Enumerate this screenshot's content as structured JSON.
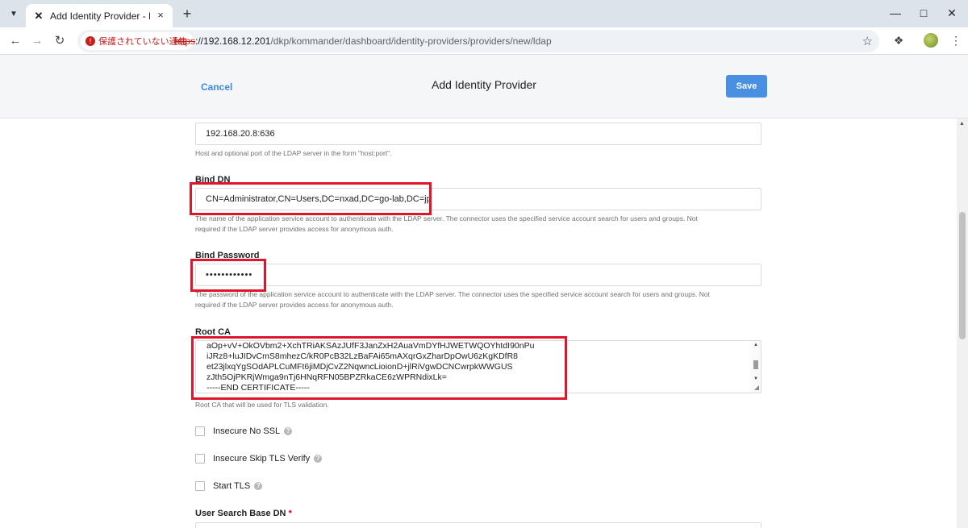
{
  "browser": {
    "tab_title": "Add Identity Provider - Nutanix",
    "tab_close": "×",
    "new_tab": "+",
    "security_label": "保護されていない通信",
    "url_scheme": "https",
    "url_host": "://192.168.12.201",
    "url_path": "/dkp/kommander/dashboard/identity-providers/providers/new/ldap"
  },
  "header": {
    "cancel_label": "Cancel",
    "title": "Add Identity Provider",
    "save_label": "Save"
  },
  "form": {
    "host": {
      "value": "192.168.20.8:636",
      "help": "Host and optional port of the LDAP server in the form \"host:port\"."
    },
    "bind_dn": {
      "label": "Bind DN",
      "value": "CN=Administrator,CN=Users,DC=nxad,DC=go-lab,DC=jp",
      "help_line1": "The name of the application service account to authenticate with the LDAP server. The connector uses the specified service account search for users and groups. Not",
      "help_line2": "required if the LDAP server provides access for anonymous auth."
    },
    "bind_password": {
      "label": "Bind Password",
      "value": "••••••••••••",
      "help_line1": "The password of the application service account to authenticate with the LDAP server. The connector uses the specified service account search for users and groups. Not",
      "help_line2": "required if the LDAP server provides access for anonymous auth."
    },
    "root_ca": {
      "label": "Root CA",
      "lines": [
        "aOp+vV+OkOVbm2+XchTRiAKSAzJUfF3JanZxH2AuaVmDYfHJWETWQOYhtdI90nPu",
        "iJRz8+luJIDvCmS8mhezC/kR0PcB32LzBaFAi65mAXqrGxZharDpOwU6zKgKDfR8",
        "et23jlxqYgSOdAPLCuMFt6jiMDjCvZ2NqwncLioionD+jlRiVgwDCNCwrpkWWGUS",
        "zJth5OjPKRjWmga9nTj6HNqRFN05BPZRkaCE6zWPRNdixLk=",
        "-----END CERTIFICATE-----"
      ],
      "help": "Root CA that will be used for TLS validation."
    },
    "checkboxes": [
      {
        "label": "Insecure No SSL",
        "checked": false
      },
      {
        "label": "Insecure Skip TLS Verify",
        "checked": false
      },
      {
        "label": "Start TLS",
        "checked": false
      }
    ],
    "user_search_base_dn": {
      "label": "User Search Base DN",
      "required_mark": "*"
    }
  },
  "colors": {
    "accent": "#4a90e2",
    "highlight": "#e0142a",
    "insecure": "#c5221f"
  }
}
